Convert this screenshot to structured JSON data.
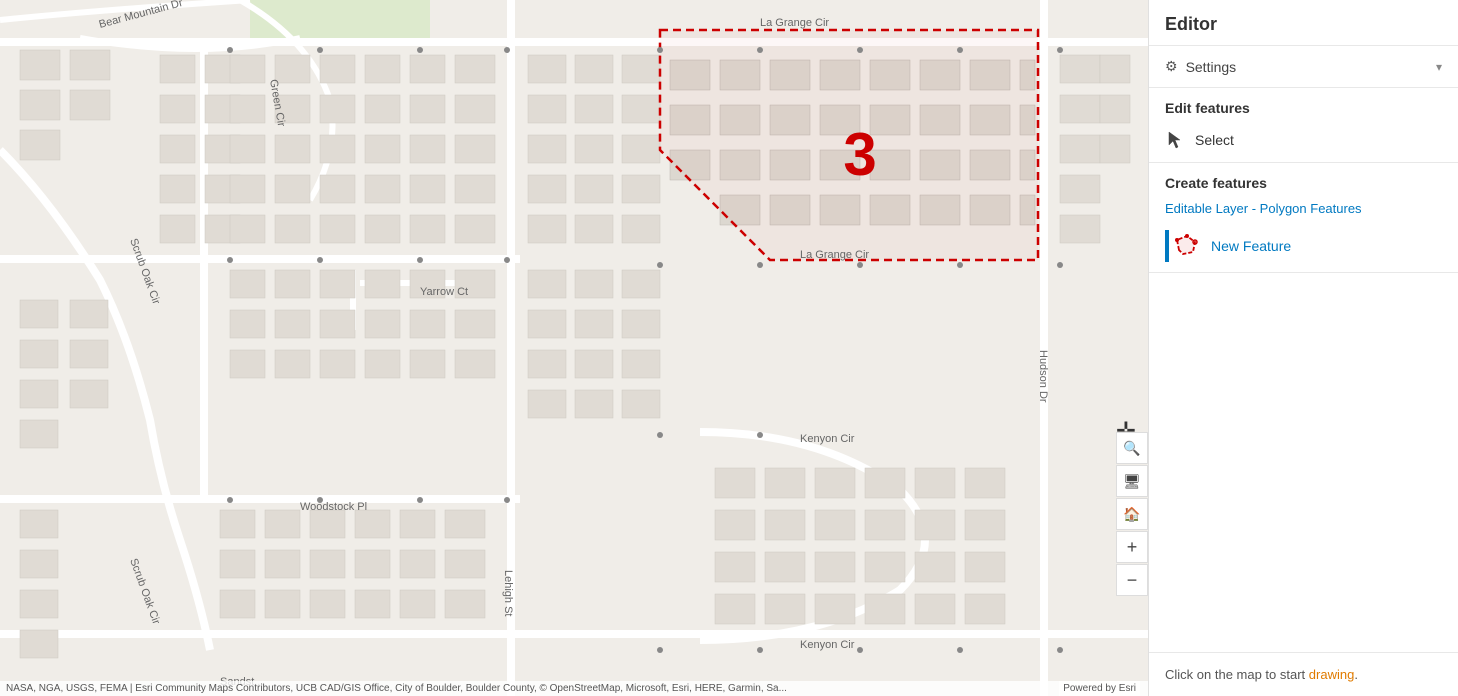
{
  "sidebar": {
    "title": "Editor",
    "settings": {
      "label": "Settings",
      "chevron": "▾"
    },
    "edit_features": {
      "label": "Edit features",
      "select": {
        "label": "Select"
      }
    },
    "create_features": {
      "label": "Create features",
      "layer_name": "Editable Layer - Polygon Features",
      "new_feature": {
        "label": "New Feature"
      }
    },
    "footer": {
      "text_start": "Click on the map to start ",
      "text_keyword": "drawing",
      "text_end": "."
    }
  },
  "map": {
    "attribution": "NASA, NGA, USGS, FEMA | Esri Community Maps Contributors, UCB CAD/GIS Office, City of Boulder, Boulder County, © OpenStreetMap, Microsoft, Esri, HERE, Garmin, Sa...",
    "powered_by": "Powered by Esri",
    "polygon_label": "3",
    "streets": [
      "Bear Mountain Dr",
      "Green Cir",
      "Scrub Oak Cir",
      "Yarrow Ct",
      "Woodstock Pl",
      "Lehigh St",
      "Kenyon Cir",
      "La Grange Cir"
    ]
  },
  "controls": {
    "search": "🔍",
    "bookmark": "🏠",
    "zoom_in": "+",
    "zoom_out": "−",
    "compass": "✛"
  }
}
